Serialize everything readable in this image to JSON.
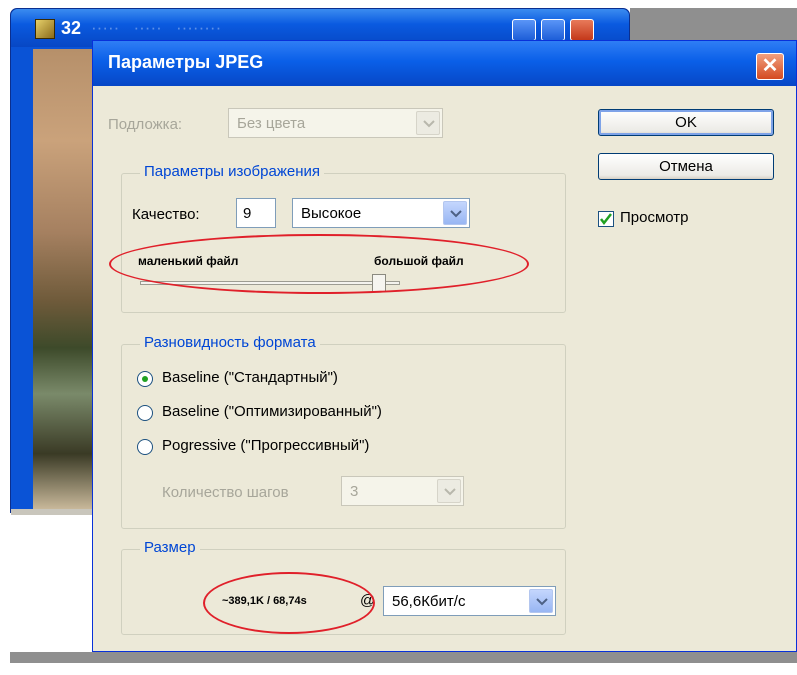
{
  "background_window": {
    "title_visible": "32"
  },
  "dialog": {
    "title": "Параметры JPEG",
    "matte_label": "Подложка:",
    "matte_value": "Без цвета",
    "ok_label": "OK",
    "cancel_label": "Отмена",
    "preview_label": "Просмотр",
    "preview_checked": true
  },
  "image_options": {
    "group_title": "Параметры изображения",
    "quality_label": "Качество:",
    "quality_value": "9",
    "quality_preset": "Высокое",
    "small_file_label": "маленький файл",
    "large_file_label": "большой файл"
  },
  "format_options": {
    "group_title": "Разновидность формата",
    "options": [
      "Baseline (\"Стандартный\")",
      "Baseline (\"Оптимизированный\")",
      "Pogressive (\"Прогрессивный\")"
    ],
    "selected_index": 0,
    "scans_label": "Количество шагов",
    "scans_value": "3"
  },
  "size": {
    "group_title": "Размер",
    "estimate": "~389,1K / 68,74s",
    "at_symbol": "@",
    "connection_speed": "56,6Кбит/с"
  },
  "colors": {
    "dialog_bg": "#ece9d8",
    "titlebar_blue": "#0a5fe8",
    "group_title_blue": "#0046d5",
    "annotation_red": "#e0202a"
  }
}
